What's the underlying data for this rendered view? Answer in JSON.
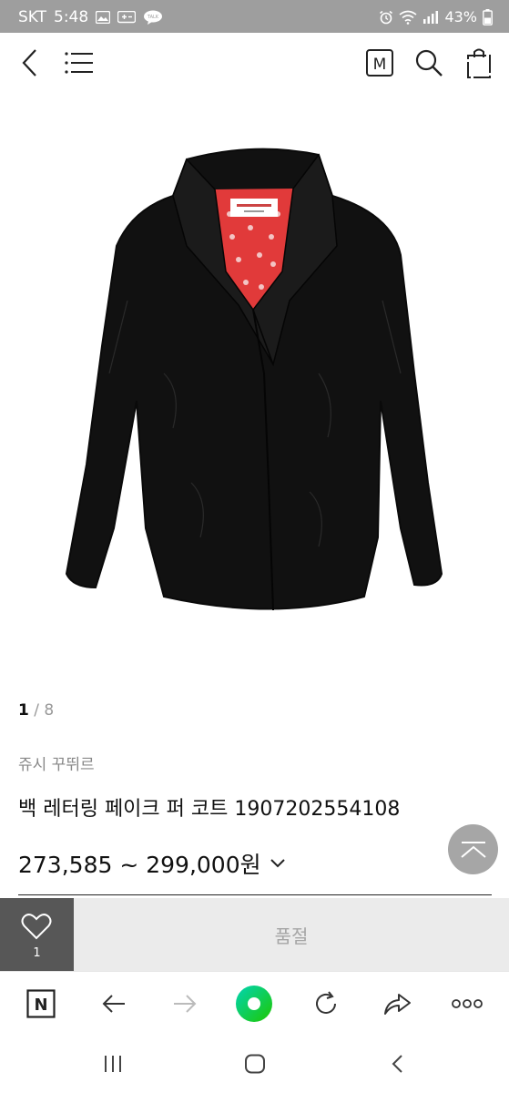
{
  "status_bar": {
    "carrier": "SKT",
    "time": "5:48",
    "talk_badge": "TALK",
    "battery": "43%"
  },
  "header": {
    "menu_badge": "M"
  },
  "product": {
    "counter_current": "1",
    "counter_sep": " / ",
    "counter_total": "8",
    "brand": "쥬시 꾸뛰르",
    "title": "백 레터링 페이크 퍼 코트 1907202554108",
    "price": "273,585 ~ 299,000원"
  },
  "buy_bar": {
    "wish_count": "1",
    "status_label": "품절"
  },
  "browser_bar": {
    "naver_logo": "N"
  },
  "icons": {
    "accent_green": "#1ec800"
  }
}
